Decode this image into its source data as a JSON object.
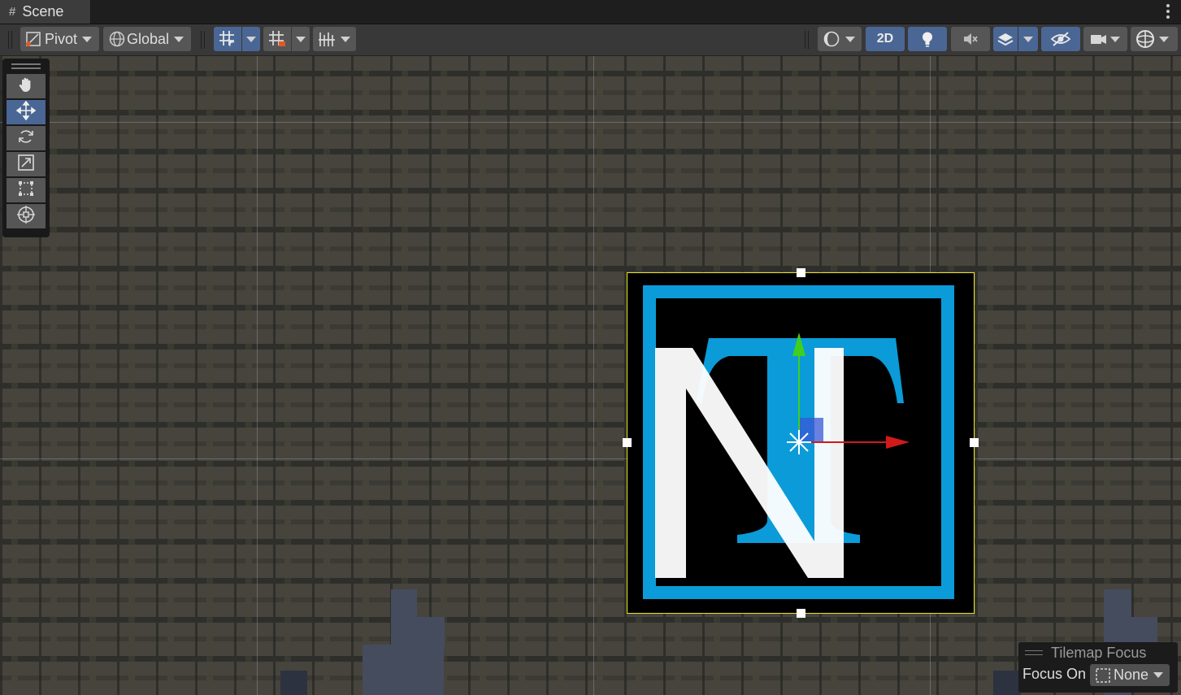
{
  "tab": {
    "title": "Scene",
    "icon": "hash-icon"
  },
  "toolbar": {
    "pivot_label": "Pivot",
    "global_label": "Global",
    "mode_2d_label": "2D"
  },
  "tools": [
    "hand-tool",
    "move-tool",
    "rotate-tool",
    "scale-tool",
    "rect-tool",
    "transform-tool"
  ],
  "tilemap_focus": {
    "title": "Tilemap Focus",
    "focus_on_label": "Focus On",
    "value": "None"
  },
  "colors": {
    "accent_active": "#4a6694",
    "selection_outline": "#e9e323",
    "logo_blue": "#0b9bd8",
    "gizmo_x": "#d11a1a",
    "gizmo_y": "#3fcf1f",
    "gizmo_z": "#3a57d6"
  }
}
